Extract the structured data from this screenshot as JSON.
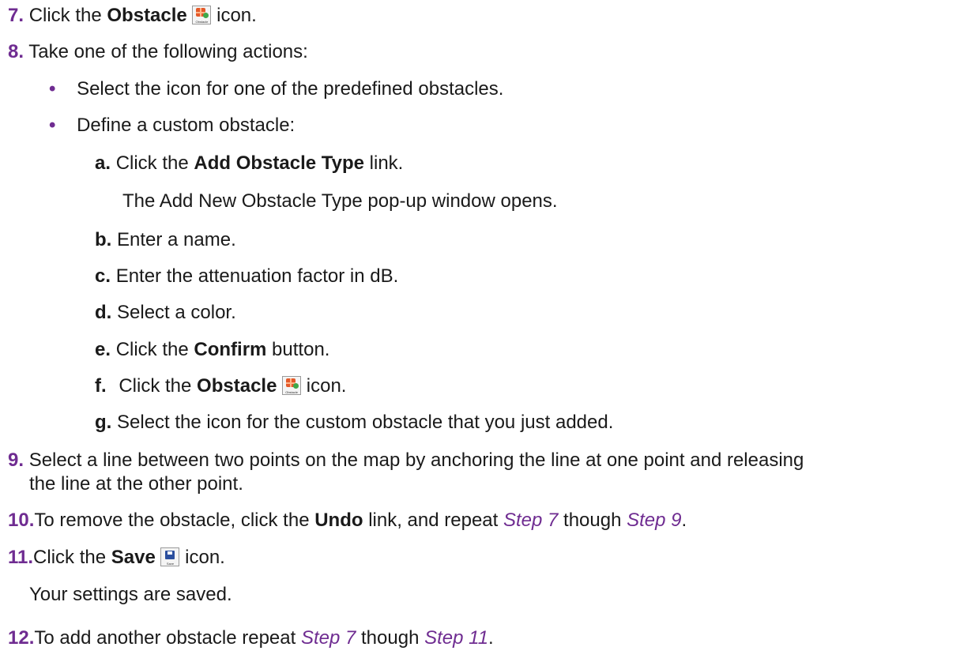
{
  "steps": {
    "s7": {
      "num": "7.",
      "pre": "Click the ",
      "bold": "Obstacle",
      "post": " icon.",
      "icon_caption": "Obstacle"
    },
    "s8": {
      "num": "8.",
      "text": "Take one of the following actions:"
    },
    "bullets": [
      {
        "mark": "•",
        "text": "Select the icon for one of the predefined obstacles."
      },
      {
        "mark": "•",
        "text": "Define a custom obstacle:"
      }
    ],
    "sub": {
      "a": {
        "letter": "a.",
        "pre": "Click the ",
        "bold": "Add Obstacle Type",
        "post": " link.",
        "result": "The Add New Obstacle Type pop-up window opens."
      },
      "b": {
        "letter": "b.",
        "text": "Enter a name."
      },
      "c": {
        "letter": "c.",
        "text": "Enter the attenuation factor in dB."
      },
      "d": {
        "letter": "d.",
        "text": "Select a color."
      },
      "e": {
        "letter": "e.",
        "pre": "Click the ",
        "bold": "Confirm",
        "post": " button."
      },
      "f": {
        "letter": "f.",
        "pre": "Click the ",
        "bold": "Obstacle",
        "post": " icon.",
        "icon_caption": "Obstacle"
      },
      "g": {
        "letter": "g.",
        "text": "Select the icon for the custom obstacle that you just added."
      }
    },
    "s9": {
      "num": "9.",
      "line1": "Select a line between two points on the map by anchoring the line at one point and releasing",
      "line2": "the line at the other point."
    },
    "s10": {
      "num": "10.",
      "pre": "To remove the obstacle, click the ",
      "bold": "Undo",
      "mid": " link, and repeat ",
      "ref1": "Step 7",
      "between": " though ",
      "ref2": "Step 9",
      "end": "."
    },
    "s11": {
      "num": "11.",
      "pre": "Click the ",
      "bold": "Save",
      "post": " icon.",
      "icon_caption": "Save",
      "result": "Your settings are saved."
    },
    "s12": {
      "num": "12.",
      "pre": "To add another obstacle repeat ",
      "ref1": "Step 7",
      "between": " though ",
      "ref2": "Step 11",
      "end": "."
    }
  },
  "colors": {
    "accent": "#6f2c91",
    "text": "#1a1a1a"
  }
}
